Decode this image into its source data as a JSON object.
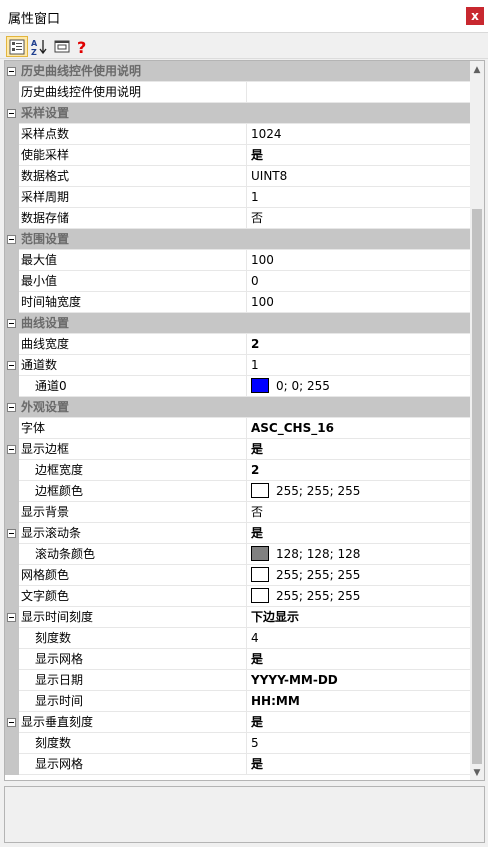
{
  "window": {
    "title": "属性窗口",
    "close_label": "x"
  },
  "toolbar": {
    "buttons": [
      {
        "icon": "categorized-icon",
        "active": true
      },
      {
        "icon": "sort-alphabetical-icon",
        "active": false
      },
      {
        "icon": "property-pages-icon",
        "active": false
      },
      {
        "icon": "help-icon",
        "active": false
      }
    ]
  },
  "grid": {
    "rows": [
      {
        "kind": "category",
        "name": "历史曲线控件使用说明"
      },
      {
        "kind": "prop",
        "name": "历史曲线控件使用说明",
        "value": ""
      },
      {
        "kind": "category",
        "name": "采样设置"
      },
      {
        "kind": "prop",
        "name": "采样点数",
        "value": "1024"
      },
      {
        "kind": "prop",
        "name": "使能采样",
        "value": "是",
        "bold": true
      },
      {
        "kind": "prop",
        "name": "数据格式",
        "value": "UINT8"
      },
      {
        "kind": "prop",
        "name": "采样周期",
        "value": "1"
      },
      {
        "kind": "prop",
        "name": "数据存储",
        "value": "否"
      },
      {
        "kind": "category",
        "name": "范围设置"
      },
      {
        "kind": "prop",
        "name": "最大值",
        "value": "100"
      },
      {
        "kind": "prop",
        "name": "最小值",
        "value": "0"
      },
      {
        "kind": "prop",
        "name": "时间轴宽度",
        "value": "100"
      },
      {
        "kind": "category",
        "name": "曲线设置"
      },
      {
        "kind": "prop",
        "name": "曲线宽度",
        "value": "2",
        "bold": true
      },
      {
        "kind": "prop",
        "name": "通道数",
        "value": "1",
        "expandable": true
      },
      {
        "kind": "prop",
        "name": "通道0",
        "value": "0; 0; 255",
        "indent": true,
        "swatch": "#0000ff"
      },
      {
        "kind": "category",
        "name": "外观设置"
      },
      {
        "kind": "prop",
        "name": "字体",
        "value": "ASC_CHS_16",
        "bold": true
      },
      {
        "kind": "prop",
        "name": "显示边框",
        "value": "是",
        "bold": true,
        "expandable": true
      },
      {
        "kind": "prop",
        "name": "边框宽度",
        "value": "2",
        "bold": true,
        "indent": true
      },
      {
        "kind": "prop",
        "name": "边框颜色",
        "value": "255; 255; 255",
        "indent": true,
        "swatch": "#ffffff"
      },
      {
        "kind": "prop",
        "name": "显示背景",
        "value": "否"
      },
      {
        "kind": "prop",
        "name": "显示滚动条",
        "value": "是",
        "bold": true,
        "expandable": true
      },
      {
        "kind": "prop",
        "name": "滚动条颜色",
        "value": "128; 128; 128",
        "indent": true,
        "swatch": "#808080"
      },
      {
        "kind": "prop",
        "name": "网格颜色",
        "value": "255; 255; 255",
        "swatch": "#ffffff"
      },
      {
        "kind": "prop",
        "name": "文字颜色",
        "value": "255; 255; 255",
        "swatch": "#ffffff"
      },
      {
        "kind": "prop",
        "name": "显示时间刻度",
        "value": "下边显示",
        "bold": true,
        "expandable": true
      },
      {
        "kind": "prop",
        "name": "刻度数",
        "value": "4",
        "indent": true
      },
      {
        "kind": "prop",
        "name": "显示网格",
        "value": "是",
        "bold": true,
        "indent": true
      },
      {
        "kind": "prop",
        "name": "显示日期",
        "value": "YYYY-MM-DD",
        "bold": true,
        "indent": true
      },
      {
        "kind": "prop",
        "name": "显示时间",
        "value": "HH:MM",
        "bold": true,
        "indent": true
      },
      {
        "kind": "prop",
        "name": "显示垂直刻度",
        "value": "是",
        "bold": true,
        "expandable": true
      },
      {
        "kind": "prop",
        "name": "刻度数",
        "value": "5",
        "indent": true
      },
      {
        "kind": "prop",
        "name": "显示网格",
        "value": "是",
        "bold": true,
        "indent": true
      }
    ]
  },
  "scrollbar": {
    "up_icon": "scroll-up-icon",
    "down_icon": "scroll-down-icon"
  },
  "description": {
    "text": ""
  }
}
